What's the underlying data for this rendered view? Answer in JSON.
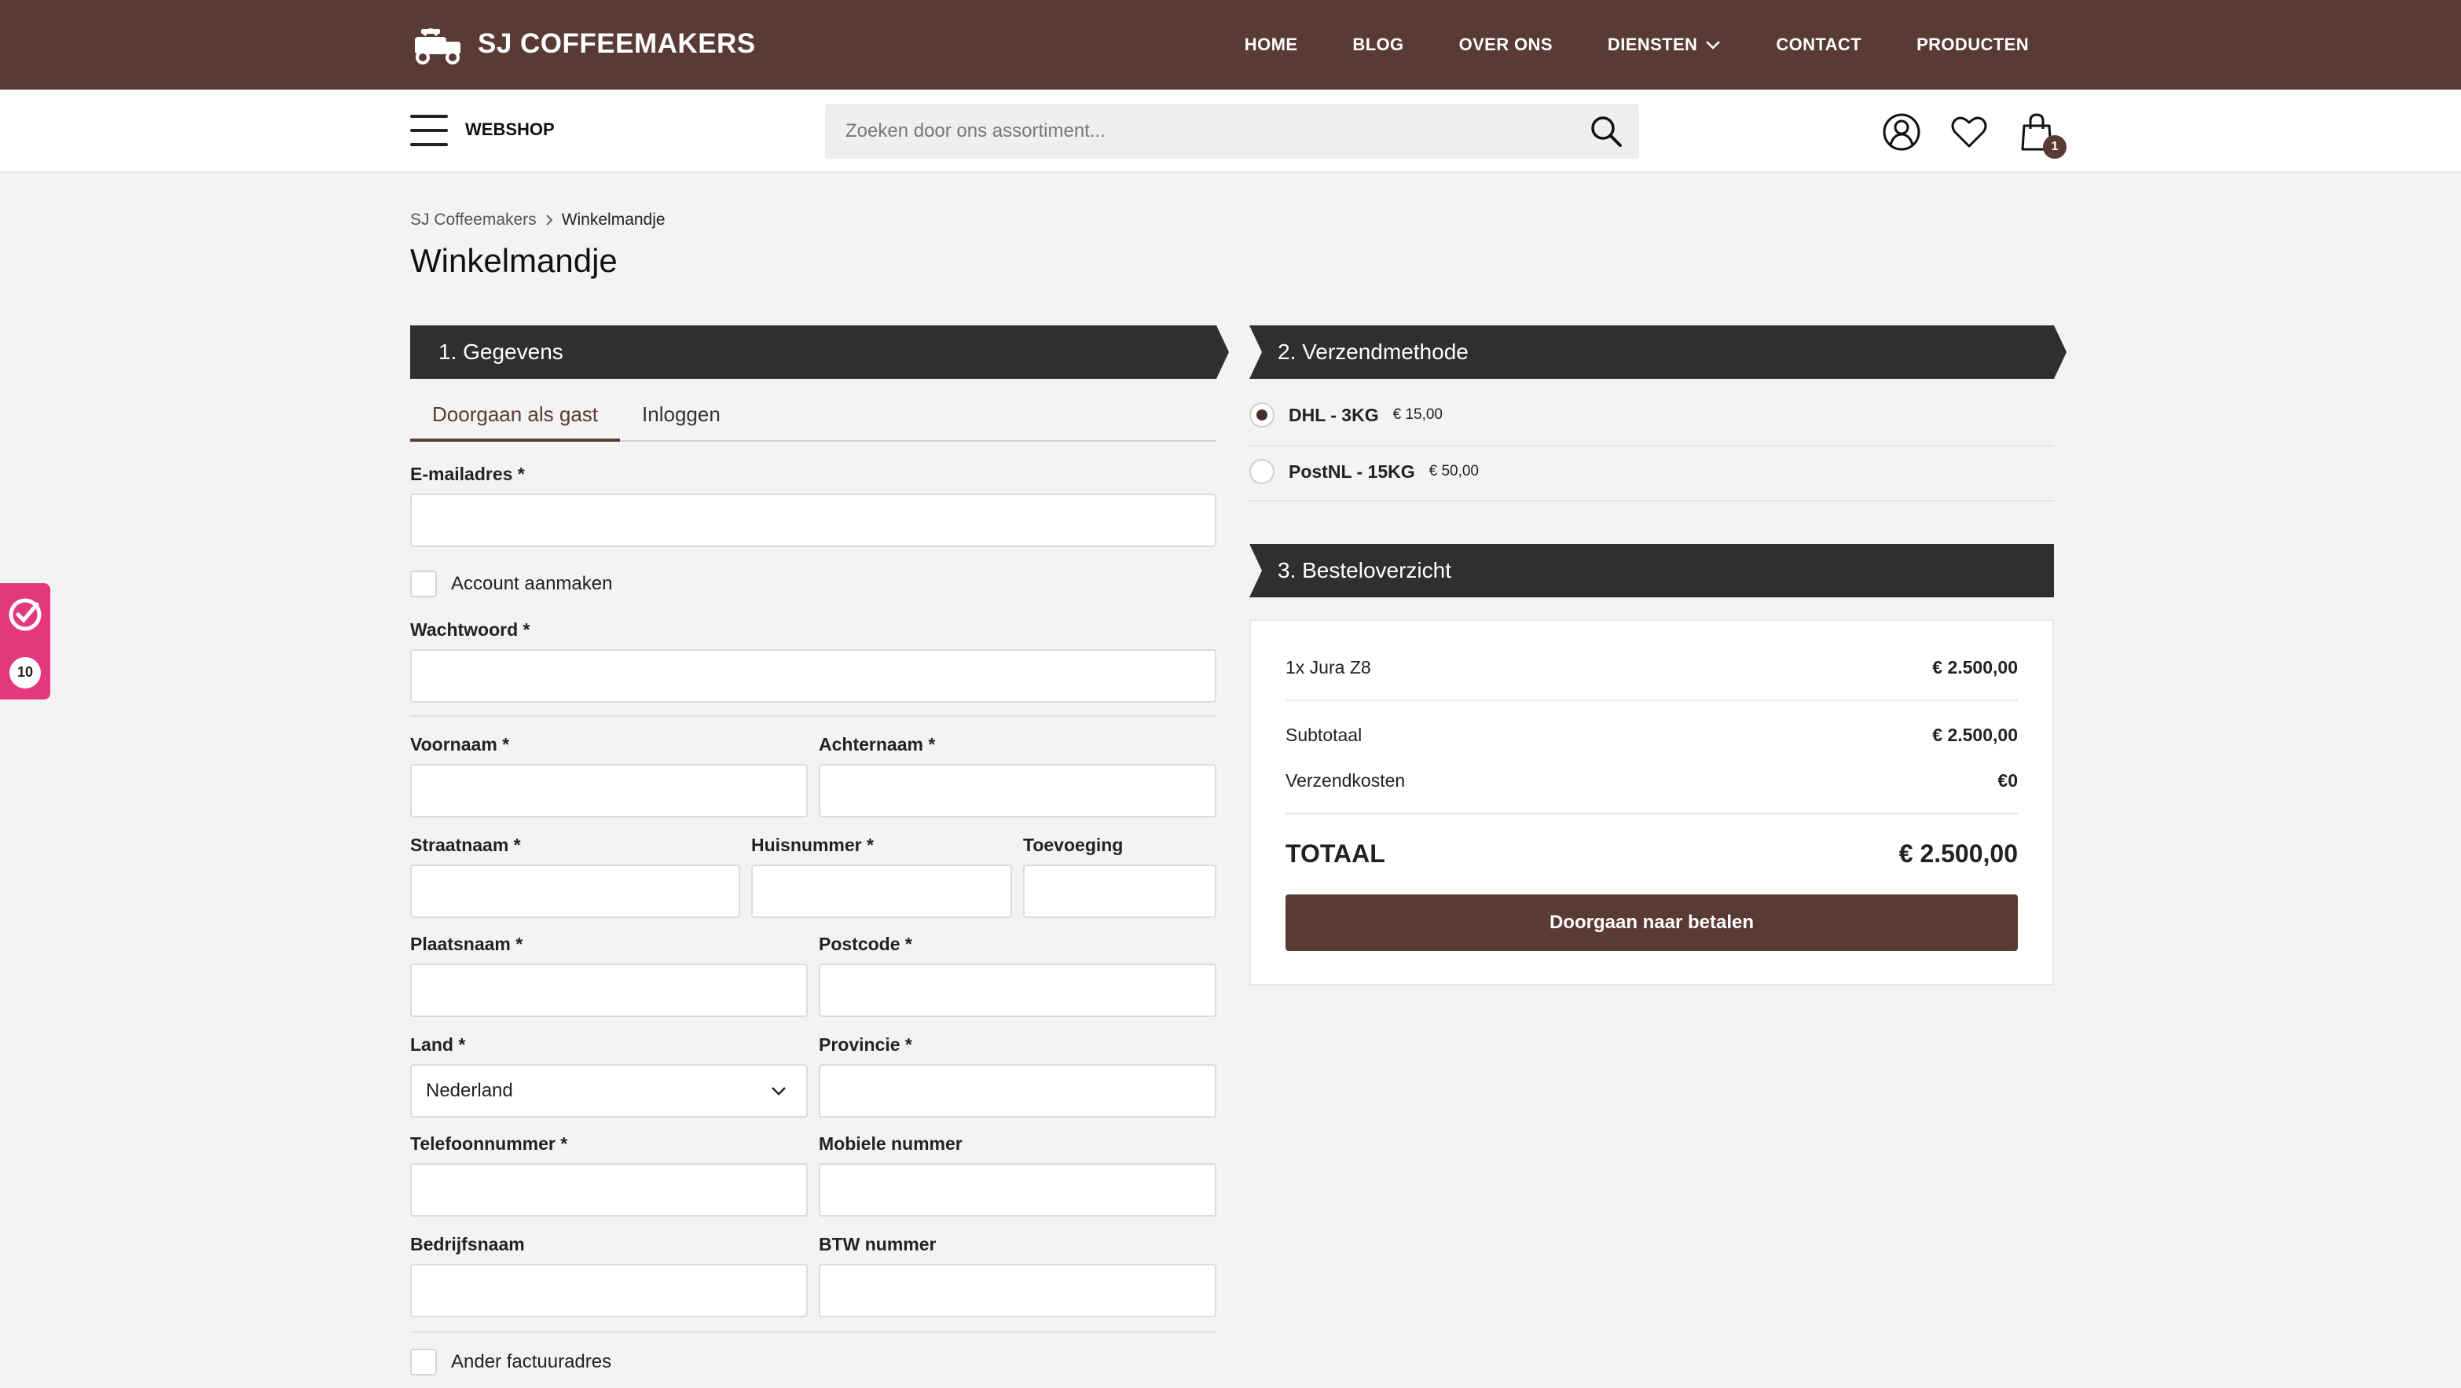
{
  "brand": {
    "name": "SJ COFFEEMAKERS",
    "logo_icon": "coffee-truck-icon"
  },
  "nav": {
    "items": [
      {
        "label": "HOME"
      },
      {
        "label": "BLOG"
      },
      {
        "label": "OVER ONS"
      },
      {
        "label": "DIENSTEN",
        "has_dropdown": true
      },
      {
        "label": "CONTACT"
      },
      {
        "label": "PRODUCTEN"
      }
    ]
  },
  "subbar": {
    "menu_label": "WEBSHOP",
    "search_placeholder": "Zoeken door ons assortiment...",
    "cart_count": "1"
  },
  "breadcrumb": {
    "home": "SJ Coffeemakers",
    "current": "Winkelmandje"
  },
  "page": {
    "title": "Winkelmandje"
  },
  "sections": {
    "details": "1. Gegevens",
    "shipping": "2. Verzendmethode",
    "overview": "3. Besteloverzicht"
  },
  "tabs": [
    {
      "label": "Doorgaan als gast",
      "active": true
    },
    {
      "label": "Inloggen",
      "active": false
    }
  ],
  "form": {
    "email": "E-mailadres *",
    "create_account": "Account aanmaken",
    "password": "Wachtwoord *",
    "first_name": "Voornaam *",
    "last_name": "Achternaam *",
    "street": "Straatnaam *",
    "house_number": "Huisnummer *",
    "addition": "Toevoeging",
    "city": "Plaatsnaam *",
    "postcode": "Postcode *",
    "country": "Land *",
    "country_value": "Nederland",
    "province": "Provincie *",
    "phone": "Telefoonnummer *",
    "mobile": "Mobiele nummer",
    "company": "Bedrijfsnaam",
    "vat": "BTW nummer",
    "other_billing": "Ander factuuradres"
  },
  "shipping": [
    {
      "name": "DHL - 3KG",
      "price": "€ 15,00",
      "selected": true
    },
    {
      "name": "PostNL - 15KG",
      "price": "€ 50,00",
      "selected": false
    }
  ],
  "summary": {
    "item": "1x Jura Z8",
    "item_price": "€ 2.500,00",
    "subtotal_label": "Subtotaal",
    "subtotal": "€ 2.500,00",
    "shipping_label": "Verzendkosten",
    "shipping_cost": "€0",
    "total_label": "TOTAAL",
    "total": "€ 2.500,00",
    "pay_button": "Doorgaan naar betalen"
  },
  "widget": {
    "rating": "10"
  },
  "colors": {
    "brand": "#5a3a34",
    "ribbon": "#2f2f2f",
    "widget": "#e4387e"
  }
}
